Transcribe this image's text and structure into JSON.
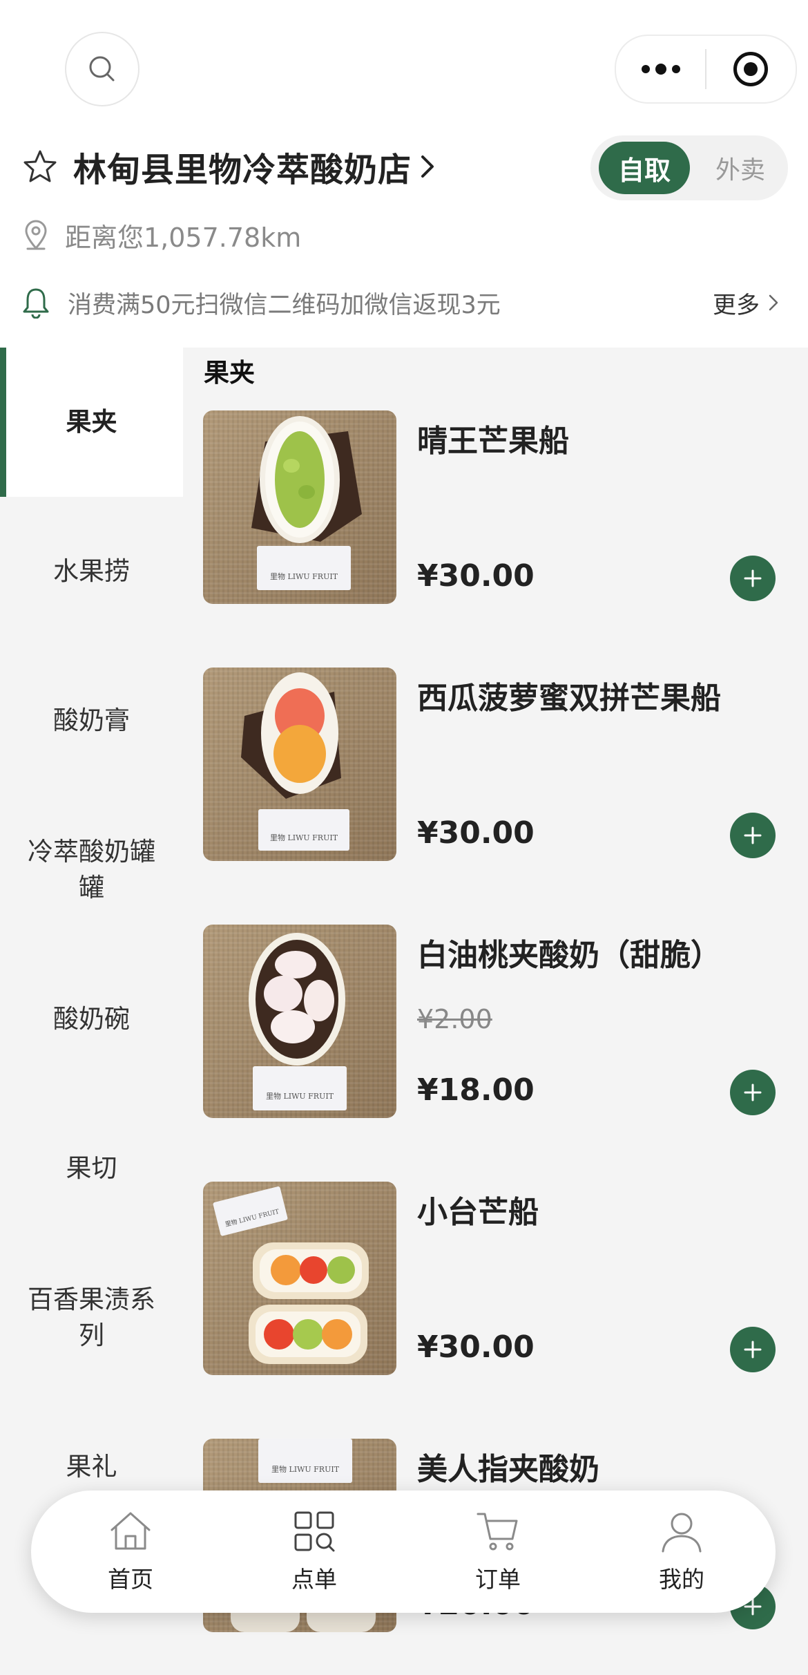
{
  "store": {
    "name": "林甸县里物冷萃酸奶店",
    "distance": "距离您1,057.78km",
    "notice": "消费满50元扫微信二维码加微信返现3元",
    "more_label": "更多",
    "mode_active": "自取",
    "mode_inactive": "外卖"
  },
  "sidebar": {
    "categories": [
      {
        "label": "果夹",
        "active": true
      },
      {
        "label": "水果捞"
      },
      {
        "label": "酸奶膏"
      },
      {
        "label": "冷萃酸奶罐罐"
      },
      {
        "label": "酸奶碗"
      },
      {
        "label": "果切"
      },
      {
        "label": "百香果渍系列"
      },
      {
        "label": "果礼"
      }
    ]
  },
  "menu": {
    "section_title": "果夹",
    "products": [
      {
        "name": "晴王芒果船",
        "price": "¥30.00"
      },
      {
        "name": "西瓜菠萝蜜双拼芒果船",
        "price": "¥30.00"
      },
      {
        "name": "白油桃夹酸奶（甜脆）",
        "old_price": "¥2.00",
        "price": "¥18.00"
      },
      {
        "name": "小台芒船",
        "price": "¥30.00"
      },
      {
        "name": "美人指夹酸奶",
        "price": "¥20.00"
      }
    ],
    "photo_brand": "里物 LIWU FRUIT"
  },
  "tabbar": {
    "tabs": [
      {
        "label": "首页",
        "icon": "home-icon"
      },
      {
        "label": "点单",
        "icon": "order-grid-icon"
      },
      {
        "label": "订单",
        "icon": "cart-icon"
      },
      {
        "label": "我的",
        "icon": "user-icon"
      }
    ]
  },
  "colors": {
    "accent": "#2f6b4a",
    "sidebar_bg": "#f4f4f4"
  }
}
